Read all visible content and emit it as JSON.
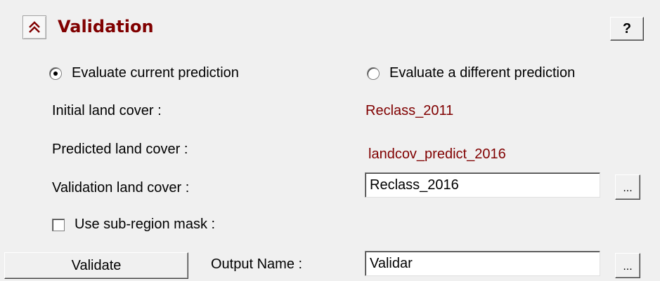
{
  "panel": {
    "title": "Validation",
    "help_label": "?"
  },
  "evaluation": {
    "option_current": "Evaluate current prediction",
    "option_different": "Evaluate a different prediction",
    "selected": "current"
  },
  "fields": {
    "initial_label": "Initial land cover :",
    "initial_value": "Reclass_2011",
    "predicted_label": "Predicted land cover :",
    "predicted_value": "landcov_predict_2016",
    "validation_label": "Validation land cover :",
    "validation_value": "Reclass_2016",
    "browse_label": "...",
    "mask_label": "Use sub-region mask :",
    "mask_checked": false,
    "output_label": "Output Name :",
    "output_value": "Validar"
  },
  "actions": {
    "validate_label": "Validate"
  },
  "colors": {
    "accent": "#800000",
    "background": "#f0f0f0"
  },
  "icons": {
    "collapse": "double-chevron-up-icon"
  }
}
